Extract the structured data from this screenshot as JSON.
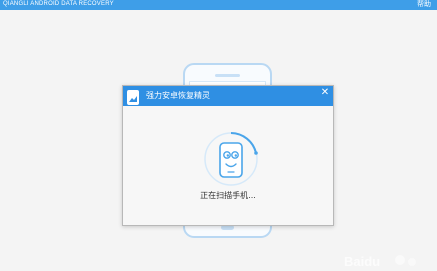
{
  "app": {
    "title": "QIANGLI ANDROID DATA RECOVERY",
    "help_label": "帮助"
  },
  "dialog": {
    "title": "强力安卓恢复精灵",
    "close_label": "✕",
    "status_text": "正在扫描手机..."
  },
  "colors": {
    "topbar": "#3e9ee8",
    "dialog_header": "#2f8fe3",
    "accent": "#4aa5ea",
    "phone_outline": "#b9d8f3",
    "text": "#333333"
  },
  "icons": {
    "logo": "app-logo-icon",
    "close": "close-icon",
    "scan": "phone-face-icon"
  }
}
